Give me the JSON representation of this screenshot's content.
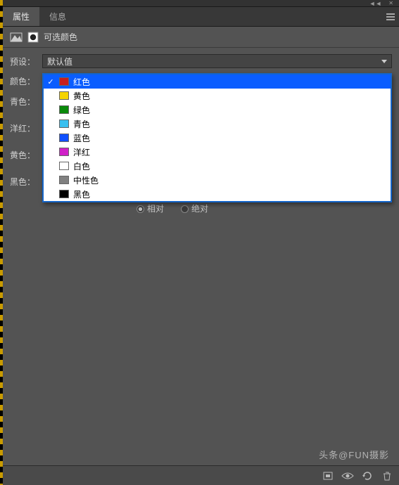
{
  "titlebar": {
    "collapse": "◄◄",
    "close": "✕"
  },
  "tabs": {
    "properties": "属性",
    "info": "信息"
  },
  "header": {
    "title": "可选颜色"
  },
  "rows": {
    "preset_label": "预设：",
    "preset_value": "默认值",
    "color_label": "颜色：",
    "color_value": "红色",
    "color_swatch": "#b02010"
  },
  "sliders": {
    "cyan": "青色：",
    "magenta": "洋红：",
    "yellow": "黄色：",
    "black": "黑色："
  },
  "method": {
    "relative": "相对",
    "absolute": "绝对"
  },
  "dropdown": {
    "items": [
      {
        "label": "红色",
        "color": "#c81e1e",
        "selected": true
      },
      {
        "label": "黄色",
        "color": "#f5d400",
        "selected": false
      },
      {
        "label": "绿色",
        "color": "#0a8a0a",
        "selected": false
      },
      {
        "label": "青色",
        "color": "#39c0f0",
        "selected": false
      },
      {
        "label": "蓝色",
        "color": "#1050ff",
        "selected": false
      },
      {
        "label": "洋红",
        "color": "#d020c8",
        "selected": false
      },
      {
        "label": "白色",
        "color": "#ffffff",
        "selected": false
      },
      {
        "label": "中性色",
        "color": "#808080",
        "selected": false
      },
      {
        "label": "黑色",
        "color": "#000000",
        "selected": false
      }
    ]
  },
  "watermark": "头条@FUN摄影"
}
